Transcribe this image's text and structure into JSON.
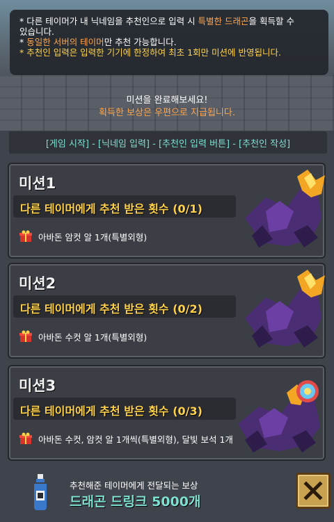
{
  "notice": {
    "line1a": "* 다른 테이머가 내 닉네임을 추천인으로 입력 시 ",
    "line1b": "특별한 드래곤",
    "line1c": "을 획득할 수",
    "line2": "있습니다.",
    "line3a": "* ",
    "line3b": "동일한 서버의 테이머",
    "line3c": "만 추천 가능합니다.",
    "line4": "* 추천인 입력은 입력한 기기에 한정하여 최초 1회만 미션에 반영됩니다."
  },
  "intro": {
    "line1": "미션을 완료해보세요!",
    "line2": "획득한 보상은 우편으로 지급됩니다."
  },
  "flow": {
    "text": "[게임 시작] - [닉네임 입력] - [추천인 입력 버튼] - [추천인 작성]"
  },
  "missions": [
    {
      "title": "미션1",
      "desc": "다른 테이머에게 추천 받은 횟수 (0/1)",
      "reward": "아바돈 암컷 알 1개(특별외형)"
    },
    {
      "title": "미션2",
      "desc": "다른 테이머에게 추천 받은 횟수 (0/2)",
      "reward": "아바돈 수컷 알 1개(특별외형)"
    },
    {
      "title": "미션3",
      "desc": "다른 테이머에게 추천 받은 횟수 (0/3)",
      "reward": "아바돈 수컷, 암컷 알 1개씩(특별외형), 달빛 보석 1개"
    }
  ],
  "bottom": {
    "subtitle": "추천해준 테이머에게 전달되는 보상",
    "reward": "드래곤 드링크 5000개",
    "close_icon": "close-x-icon"
  },
  "colors": {
    "highlight_orange": "#ffa64d",
    "mission_yellow": "#ffd24a",
    "teal": "#7ee0d0"
  }
}
